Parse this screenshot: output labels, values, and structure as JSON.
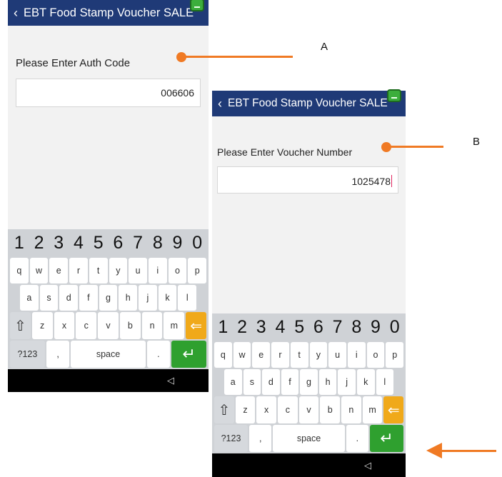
{
  "screen_a": {
    "title": "EBT Food Stamp Voucher SALE",
    "prompt": "Please Enter Auth Code",
    "value": "006606"
  },
  "screen_b": {
    "title": "EBT Food Stamp Voucher SALE",
    "prompt": "Please Enter Voucher Number",
    "value": "1025478"
  },
  "keyboard": {
    "numbers": [
      "1",
      "2",
      "3",
      "4",
      "5",
      "6",
      "7",
      "8",
      "9",
      "0"
    ],
    "row1": [
      "q",
      "w",
      "e",
      "r",
      "t",
      "y",
      "u",
      "i",
      "o",
      "p"
    ],
    "row2": [
      "a",
      "s",
      "d",
      "f",
      "g",
      "h",
      "j",
      "k",
      "l"
    ],
    "row3": [
      "z",
      "x",
      "c",
      "v",
      "b",
      "n",
      "m"
    ],
    "symbols_label": "?123",
    "comma": ",",
    "space_label": "space",
    "period": ".",
    "shift_glyph": "⇧",
    "backspace_glyph": "⇐",
    "enter_glyph": "↵",
    "nav_back_glyph": "◁"
  },
  "callouts": {
    "a": "A",
    "b": "B"
  },
  "icons": {
    "back": "chevron-left-icon",
    "status": "terminal-status-icon"
  },
  "colors": {
    "header": "#1f3a77",
    "callout": "#f07a24",
    "enter_key": "#2fa02f",
    "backspace_key": "#f0a91a"
  }
}
